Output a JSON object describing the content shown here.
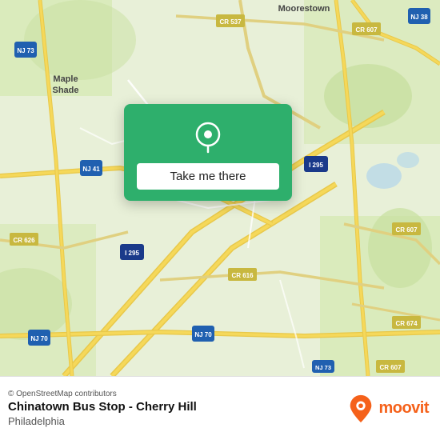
{
  "map": {
    "alt": "Map of Cherry Hill area, New Jersey"
  },
  "card": {
    "button_label": "Take me there",
    "pin_alt": "location pin"
  },
  "bottom_bar": {
    "osm_credit": "© OpenStreetMap contributors",
    "location_name": "Chinatown Bus Stop - Cherry Hill",
    "location_city": "Philadelphia",
    "moovit_label": "moovit"
  }
}
